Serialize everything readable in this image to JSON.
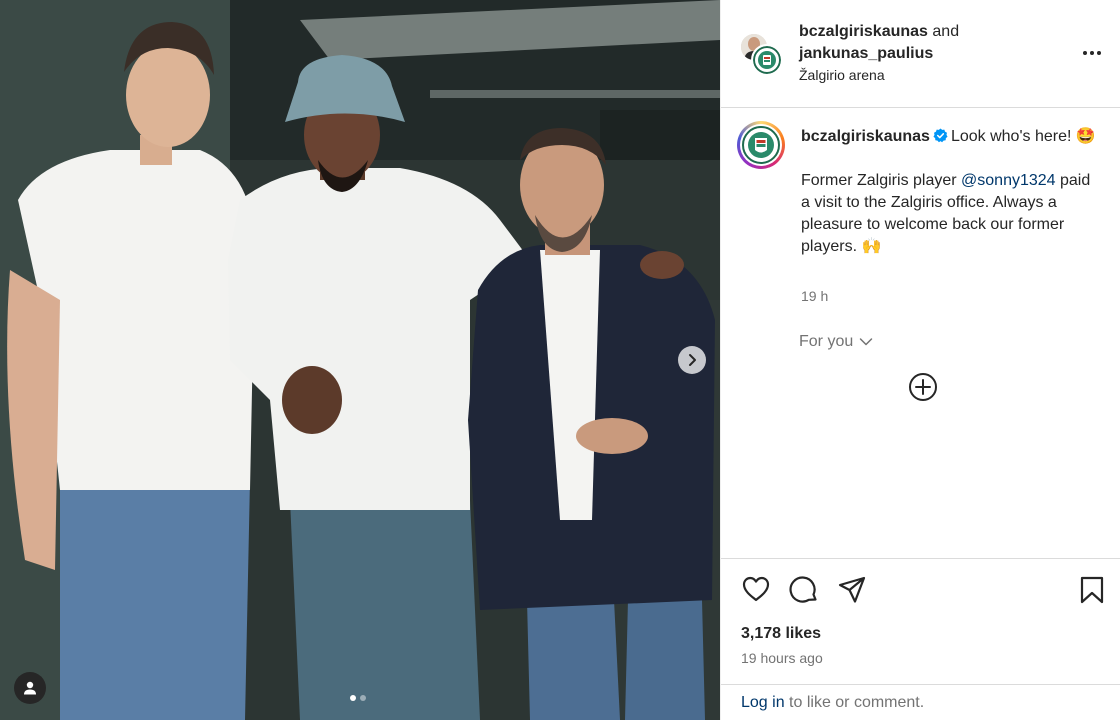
{
  "post": {
    "header": {
      "author1": "bczalgiriskaunas",
      "joiner": "and",
      "author2": "jankunas_paulius",
      "location": "Žalgirio arena"
    },
    "caption": {
      "author": "bczalgiriskaunas",
      "line1": "Look who's here! 🤩",
      "line2a": "Former Zalgiris player ",
      "mention": "@sonny1324",
      "line2b": " paid a visit to the Zalgiris office. Always a pleasure to welcome back our former players. 🙌",
      "time": "19 h"
    },
    "for_you": "For you",
    "likes": "3,178 likes",
    "posted_ago": "19 hours ago",
    "login": {
      "link": "Log in",
      "rest": " to like or comment."
    },
    "carousel": {
      "current": 1,
      "total": 2
    }
  },
  "icons": {
    "more": "more-options-icon",
    "verified": "verified-badge-icon",
    "like": "heart-icon",
    "comment": "comment-bubble-icon",
    "share": "send-paper-plane-icon",
    "save": "bookmark-icon",
    "next": "chevron-right-icon",
    "tag": "user-tag-icon",
    "expand": "plus-circle-icon"
  },
  "colors": {
    "link": "#00376b",
    "verified": "#0095f6",
    "muted": "#737373",
    "text": "#262626"
  }
}
